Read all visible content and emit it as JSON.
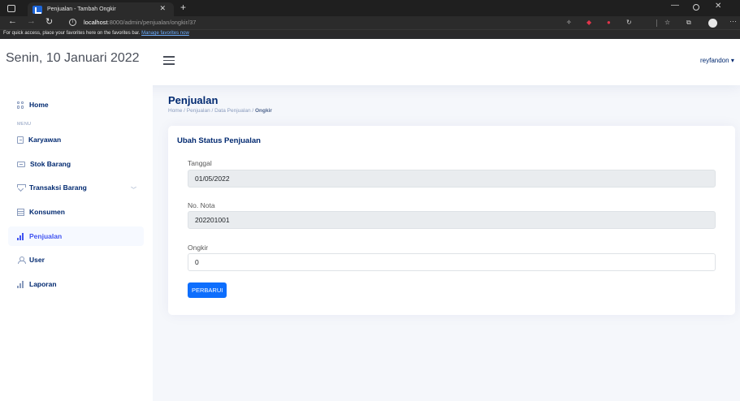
{
  "browser": {
    "tab_title": "Penjualan - Tambah Ongkir",
    "url_host": "localhost",
    "url_path": ":8000/admin/penjualan/ongkir/37",
    "favorites_text": "For quick access, place your favorites here on the favorites bar.",
    "favorites_link": "Manage favorites now"
  },
  "header": {
    "date": "Senin, 10 Januari 2022",
    "user": "reyfandon"
  },
  "sidebar": {
    "menu_label": "MENU",
    "items": [
      {
        "label": "Home",
        "icon": "grid-icon"
      },
      {
        "label": "Karyawan",
        "icon": "document-icon"
      },
      {
        "label": "Stok Barang",
        "icon": "box-icon"
      },
      {
        "label": "Transaksi Barang",
        "icon": "gem-icon"
      },
      {
        "label": "Konsumen",
        "icon": "table-icon"
      },
      {
        "label": "Penjualan",
        "icon": "bar-chart-icon",
        "active": true
      },
      {
        "label": "User",
        "icon": "person-icon"
      },
      {
        "label": "Laporan",
        "icon": "bar-chart-icon"
      }
    ]
  },
  "page": {
    "title": "Penjualan",
    "breadcrumb": [
      "Home",
      "Penjualan",
      "Data Penjualan",
      "Ongkir"
    ]
  },
  "form": {
    "title": "Ubah Status Penjualan",
    "fields": [
      {
        "label": "Tanggal",
        "value": "01/05/2022",
        "readonly": true
      },
      {
        "label": "No. Nota",
        "value": "202201001",
        "readonly": true
      },
      {
        "label": "Ongkir",
        "value": "0",
        "readonly": false
      }
    ],
    "submit_label": "PERBARUI"
  },
  "colors": {
    "accent": "#4154f1",
    "text": "#012970",
    "button": "#0d6efd",
    "background": "#f5f7fb"
  }
}
